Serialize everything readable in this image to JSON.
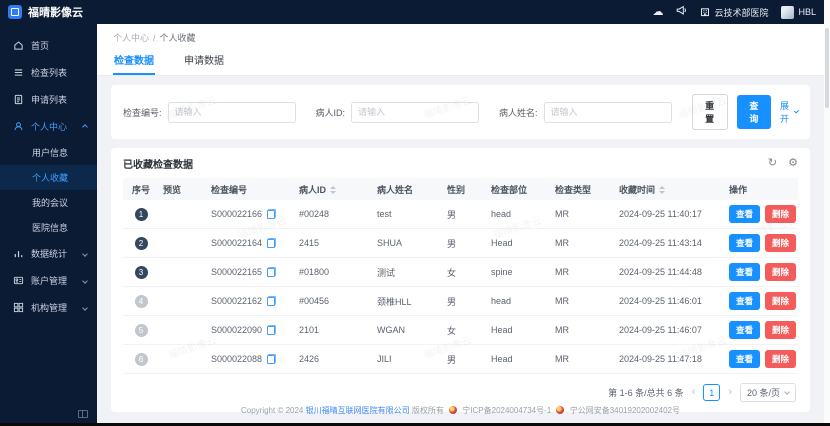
{
  "topbar": {
    "logo_text": "福晴影像云",
    "hospital": "云技术部医院",
    "user": "HBL",
    "icons": [
      "cloud-icon",
      "megaphone-icon",
      "hospital-icon"
    ]
  },
  "sidebar": {
    "items": [
      {
        "label": "首页",
        "icon": "home-icon"
      },
      {
        "label": "检查列表",
        "icon": "list-icon"
      },
      {
        "label": "申请列表",
        "icon": "document-icon"
      },
      {
        "label": "个人中心",
        "icon": "user-icon",
        "expanded": true,
        "children": [
          {
            "label": "用户信息"
          },
          {
            "label": "个人收藏",
            "active": true
          },
          {
            "label": "我的会议"
          },
          {
            "label": "医院信息"
          }
        ]
      },
      {
        "label": "数据统计",
        "icon": "chart-icon"
      },
      {
        "label": "账户管理",
        "icon": "account-icon"
      },
      {
        "label": "机构管理",
        "icon": "org-icon"
      }
    ]
  },
  "breadcrumb": {
    "parent": "个人中心",
    "separator": "/",
    "current": "个人收藏"
  },
  "tabs": [
    {
      "label": "检查数据",
      "active": true
    },
    {
      "label": "申请数据",
      "active": false
    }
  ],
  "filters": {
    "fields": [
      {
        "label": "检查编号:",
        "placeholder": "请输入",
        "value": ""
      },
      {
        "label": "病人ID:",
        "placeholder": "请输入",
        "value": ""
      },
      {
        "label": "病人姓名:",
        "placeholder": "请输入",
        "value": ""
      }
    ],
    "reset_label": "重 置",
    "search_label": "查 询",
    "expand_label": "展开"
  },
  "table": {
    "title": "已收藏检查数据",
    "columns": [
      "序号",
      "预览",
      "检查编号",
      "病人ID",
      "病人姓名",
      "性别",
      "检查部位",
      "检查类型",
      "收藏时间",
      "操作"
    ],
    "view_label": "查看",
    "delete_label": "删除",
    "rows": [
      {
        "index": "1",
        "exam_no": "S000022166",
        "patient_id": "#00248",
        "patient_name": "test",
        "gender": "男",
        "body_part": "head",
        "exam_type": "MR",
        "fav_time": "2024-09-25 11:40:17"
      },
      {
        "index": "2",
        "exam_no": "S000022164",
        "patient_id": "2415",
        "patient_name": "SHUA",
        "gender": "男",
        "body_part": "Head",
        "exam_type": "MR",
        "fav_time": "2024-09-25 11:43:14"
      },
      {
        "index": "3",
        "exam_no": "S000022165",
        "patient_id": "#01800",
        "patient_name": "测试",
        "gender": "女",
        "body_part": "spine",
        "exam_type": "MR",
        "fav_time": "2024-09-25 11:44:48"
      },
      {
        "index": "4",
        "exam_no": "S000022162",
        "patient_id": "#00456",
        "patient_name": "颈椎HLL",
        "gender": "男",
        "body_part": "head",
        "exam_type": "MR",
        "fav_time": "2024-09-25 11:46:01"
      },
      {
        "index": "5",
        "exam_no": "S000022090",
        "patient_id": "2101",
        "patient_name": "WGAN",
        "gender": "女",
        "body_part": "Head",
        "exam_type": "MR",
        "fav_time": "2024-09-25 11:46:07"
      },
      {
        "index": "6",
        "exam_no": "S000022088",
        "patient_id": "2426",
        "patient_name": "JILI",
        "gender": "男",
        "body_part": "Head",
        "exam_type": "MR",
        "fav_time": "2024-09-25 11:47:18"
      }
    ]
  },
  "pagination": {
    "total_text": "第 1-6 条/总共 6 条",
    "current_page": "1",
    "page_size_label": "20 条/页"
  },
  "footer": {
    "copyright": "Copyright © 2024",
    "company": "银川福晴互联网医院有限公司",
    "rights": "版权所有",
    "icp": "宁ICP备2024004734号-1",
    "police": "宁公网安备34019202002402号"
  },
  "watermark": {
    "text": "福晴影像云"
  }
}
